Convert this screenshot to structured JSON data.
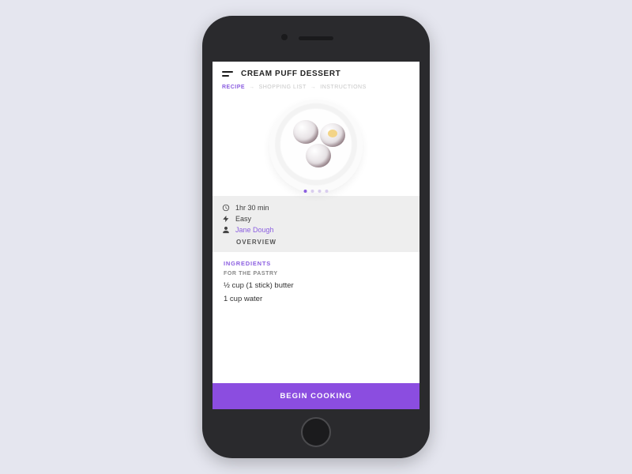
{
  "header": {
    "title": "CREAM PUFF DESSERT",
    "breadcrumbs": [
      "RECIPE",
      "SHOPPING LIST",
      "INSTRUCTIONS"
    ],
    "active_index": 0
  },
  "carousel": {
    "count": 4,
    "active": 0
  },
  "meta": {
    "time": "1hr 30 min",
    "difficulty": "Easy",
    "author": "Jane Dough"
  },
  "overview_label": "OVERVIEW",
  "ingredients": {
    "heading": "INGREDIENTS",
    "section": "FOR THE PASTRY",
    "items": [
      "½ cup (1 stick) butter",
      "1 cup water"
    ]
  },
  "cta": "BEGIN COOKING",
  "colors": {
    "accent": "#8b5ee0",
    "cta": "#8b4de0"
  }
}
